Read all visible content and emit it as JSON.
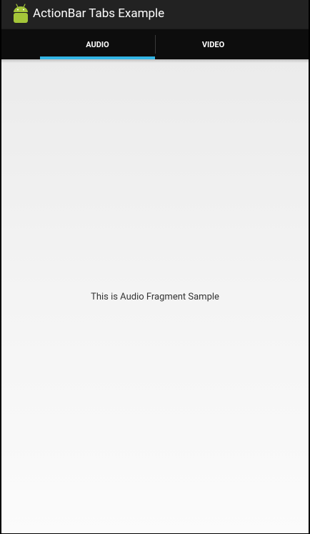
{
  "app": {
    "title": "ActionBar Tabs Example",
    "icon": "android-robot-icon"
  },
  "tabs": [
    {
      "label": "AUDIO",
      "selected": true
    },
    {
      "label": "VIDEO",
      "selected": false
    }
  ],
  "content": {
    "text": "This is Audio Fragment Sample"
  },
  "colors": {
    "action_bar": "#222222",
    "tab_bar": "#0d0d0d",
    "indicator": "#33b5e5",
    "android_green": "#a4c639"
  }
}
